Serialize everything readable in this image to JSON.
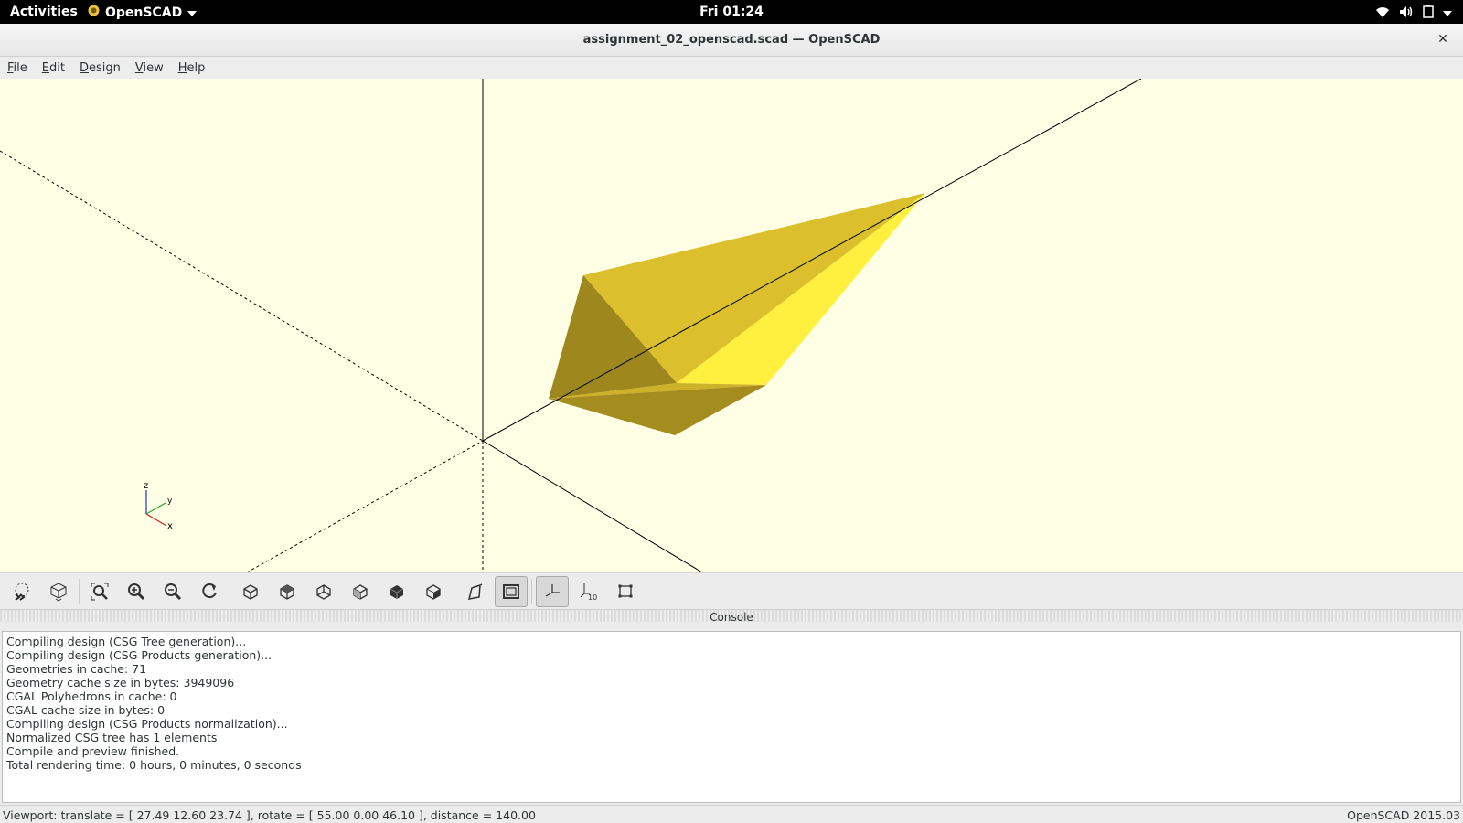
{
  "topbar": {
    "activities": "Activities",
    "app_menu": "OpenSCAD",
    "clock": "Fri 01:24"
  },
  "window": {
    "title": "assignment_02_openscad.scad — OpenSCAD"
  },
  "menubar": {
    "items": [
      {
        "label": "File",
        "mnemonic": "F",
        "rest": "ile"
      },
      {
        "label": "Edit",
        "mnemonic": "E",
        "rest": "dit"
      },
      {
        "label": "Design",
        "mnemonic": "D",
        "rest": "esign"
      },
      {
        "label": "View",
        "mnemonic": "V",
        "rest": "iew"
      },
      {
        "label": "Help",
        "mnemonic": "H",
        "rest": "elp"
      }
    ]
  },
  "axes_indicator": {
    "z": "z",
    "y": "y",
    "x": "x"
  },
  "model_colors": {
    "background": "#ffffe5",
    "face_light": "#ffeb3b",
    "face_mid": "#dfc02a",
    "face_dark": "#a8901f"
  },
  "toolbar": {
    "buttons": [
      {
        "icon": "preview-icon"
      },
      {
        "icon": "render-icon"
      },
      {
        "icon": "view-all-icon"
      },
      {
        "icon": "zoom-in-icon"
      },
      {
        "icon": "zoom-out-icon"
      },
      {
        "icon": "reset-view-icon"
      },
      {
        "icon": "view-right-icon"
      },
      {
        "icon": "view-top-icon"
      },
      {
        "icon": "view-bottom-icon"
      },
      {
        "icon": "view-left-icon"
      },
      {
        "icon": "view-front-icon"
      },
      {
        "icon": "view-back-icon"
      },
      {
        "icon": "perspective-icon"
      },
      {
        "icon": "orthogonal-icon",
        "active": true
      },
      {
        "icon": "show-axes-icon",
        "active": true
      },
      {
        "icon": "show-scale-markers-icon"
      },
      {
        "icon": "show-edges-icon"
      }
    ],
    "scale_label": "10"
  },
  "console": {
    "title": "Console",
    "lines": [
      "Compiling design (CSG Tree generation)...",
      "Compiling design (CSG Products generation)...",
      "Geometries in cache: 71",
      "Geometry cache size in bytes: 3949096",
      "CGAL Polyhedrons in cache: 0",
      "CGAL cache size in bytes: 0",
      "Compiling design (CSG Products normalization)...",
      "Normalized CSG tree has 1 elements",
      "Compile and preview finished.",
      "Total rendering time: 0 hours, 0 minutes, 0 seconds"
    ]
  },
  "statusbar": {
    "viewport": "Viewport: translate = [ 27.49 12.60 23.74 ], rotate = [ 55.00 0.00 46.10 ], distance = 140.00",
    "version": "OpenSCAD 2015.03"
  }
}
